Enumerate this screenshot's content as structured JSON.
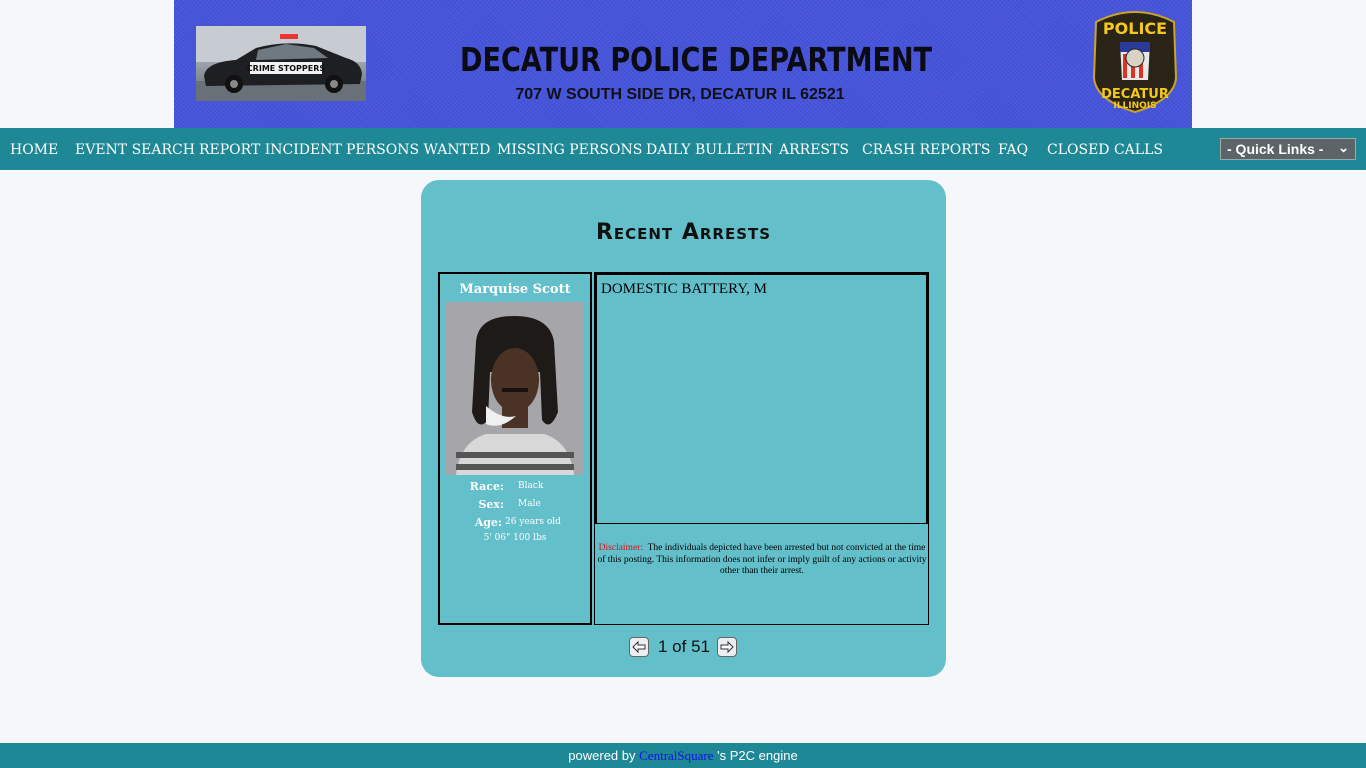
{
  "header": {
    "title": "DECATUR POLICE DEPARTMENT",
    "address": "707 W SOUTH SIDE DR, DECATUR IL 62521",
    "car_image": "crime-stoppers-police-car-photo",
    "car_text": "CRIME STOPPERS",
    "badge_image": "decatur-police-badge",
    "badge_top": "POLICE",
    "badge_bottom": "DECATUR",
    "badge_bottom2": "ILLINOIS"
  },
  "nav": {
    "items": [
      "HOME",
      "EVENT SEARCH",
      "REPORT INCIDENT",
      "PERSONS WANTED",
      "MISSING PERSONS",
      "DAILY BULLETIN",
      "ARRESTS",
      "CRASH REPORTS",
      "FAQ",
      "CLOSED CALLS"
    ],
    "quick_links": "- Quick Links -"
  },
  "arrests": {
    "title": "Recent Arrests",
    "person": {
      "name": "Marquise Scott",
      "race_label": "Race:",
      "race": "Black",
      "sex_label": "Sex:",
      "sex": "Male",
      "age_label": "Age:",
      "age": "26 years old",
      "height_weight": "5' 06\" 100 lbs"
    },
    "charge": "DOMESTIC BATTERY, M",
    "disclaimer_label": "Disclaimer:",
    "disclaimer_text": "The individuals depicted have been arrested but not convicted at the time of this posting.   This information does not infer or imply guilt of any actions or activity other than their arrest.",
    "pager": "1 of 51"
  },
  "footer": {
    "prefix": "powered by",
    "link": "CentralSquare",
    "suffix": "'s P2C engine"
  },
  "colors": {
    "banner": "#4654dc",
    "nav": "#1f8896",
    "card": "#63bfca",
    "disclaimer_label": "#d8141c"
  }
}
